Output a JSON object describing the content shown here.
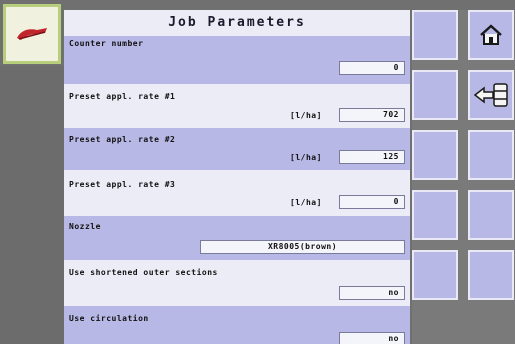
{
  "header": {
    "title": "Job Parameters"
  },
  "rows": [
    {
      "label": "Counter number",
      "unit": "",
      "value": "0"
    },
    {
      "label": "Preset appl. rate #1",
      "unit": "[l/ha]",
      "value": "702"
    },
    {
      "label": "Preset appl. rate #2",
      "unit": "[l/ha]",
      "value": "125"
    },
    {
      "label": "Preset appl. rate #3",
      "unit": "[l/ha]",
      "value": "0"
    },
    {
      "label": "Nozzle",
      "unit": "",
      "value": "XR8005(brown)"
    },
    {
      "label": "Use shortened outer sections",
      "unit": "",
      "value": "no"
    },
    {
      "label": "Use circulation",
      "unit": "",
      "value": "no"
    }
  ],
  "icons": {
    "logo": "sprayer-logo-icon",
    "home": "home-icon",
    "back": "back-arrow-icon"
  },
  "colors": {
    "panel_light": "#ececf6",
    "panel_dark": "#b8b8e6",
    "logo_border": "#b7cf7d",
    "background": "#707070"
  }
}
